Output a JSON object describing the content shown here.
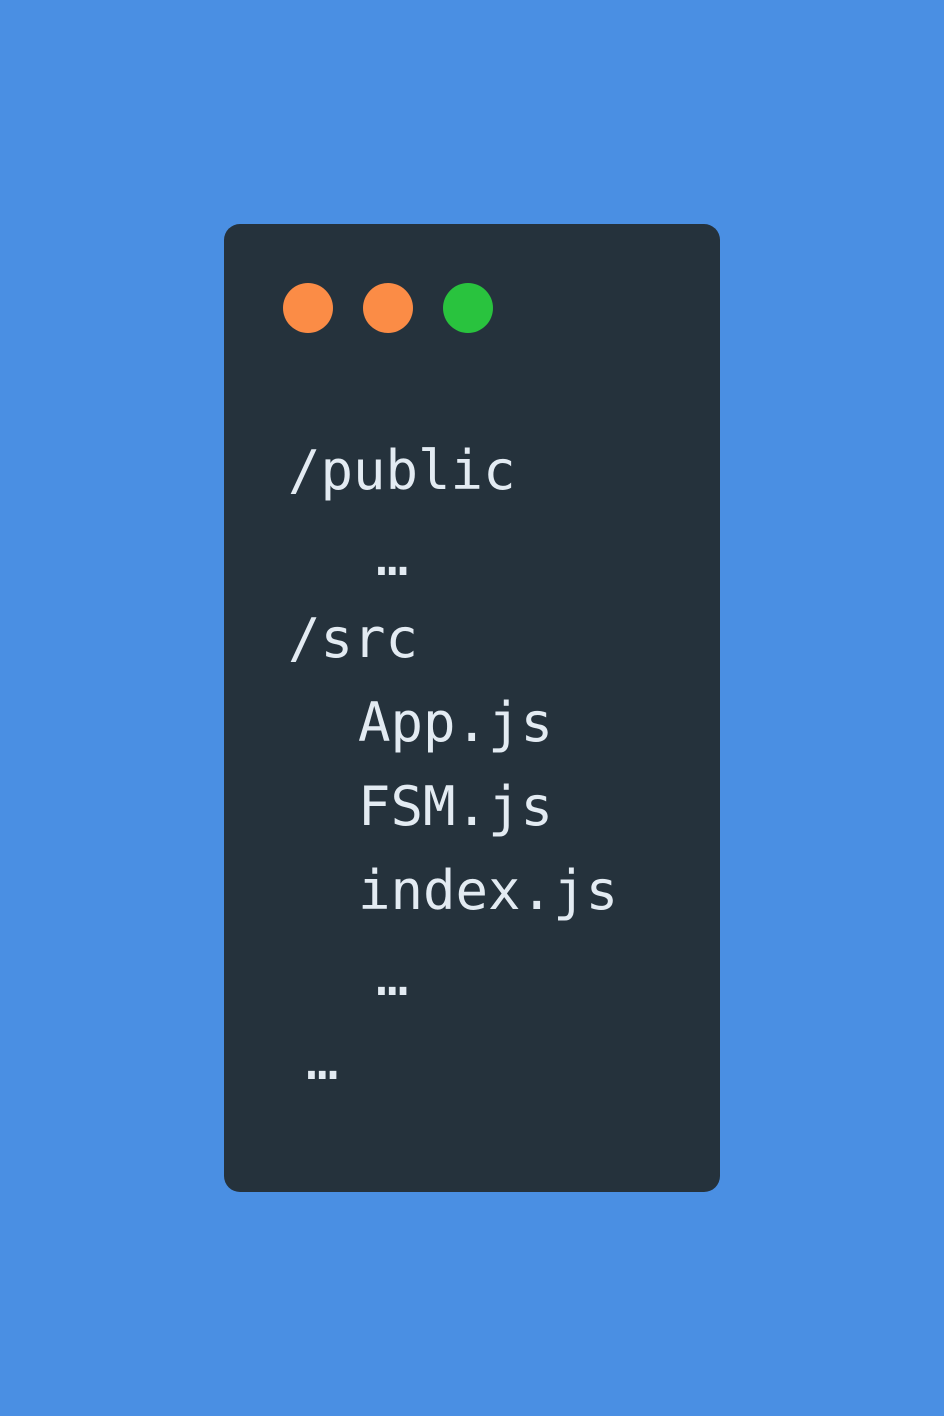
{
  "window": {
    "background": "#25323c",
    "controls": [
      {
        "name": "window-control-dot-1",
        "color": "#fb8c46"
      },
      {
        "name": "window-control-dot-2",
        "color": "#fb8c46"
      },
      {
        "name": "window-control-dot-3",
        "color": "#29c33e"
      }
    ]
  },
  "tree": {
    "lines": [
      {
        "text": "/public"
      },
      {
        "text": "…"
      },
      {
        "text": "/src"
      },
      {
        "text": "App.js"
      },
      {
        "text": "FSM.js"
      },
      {
        "text": "index.js"
      },
      {
        "text": "…"
      },
      {
        "text": "…"
      }
    ]
  },
  "colors": {
    "page_background": "#4a8fe3",
    "text": "#e3ebf2"
  }
}
